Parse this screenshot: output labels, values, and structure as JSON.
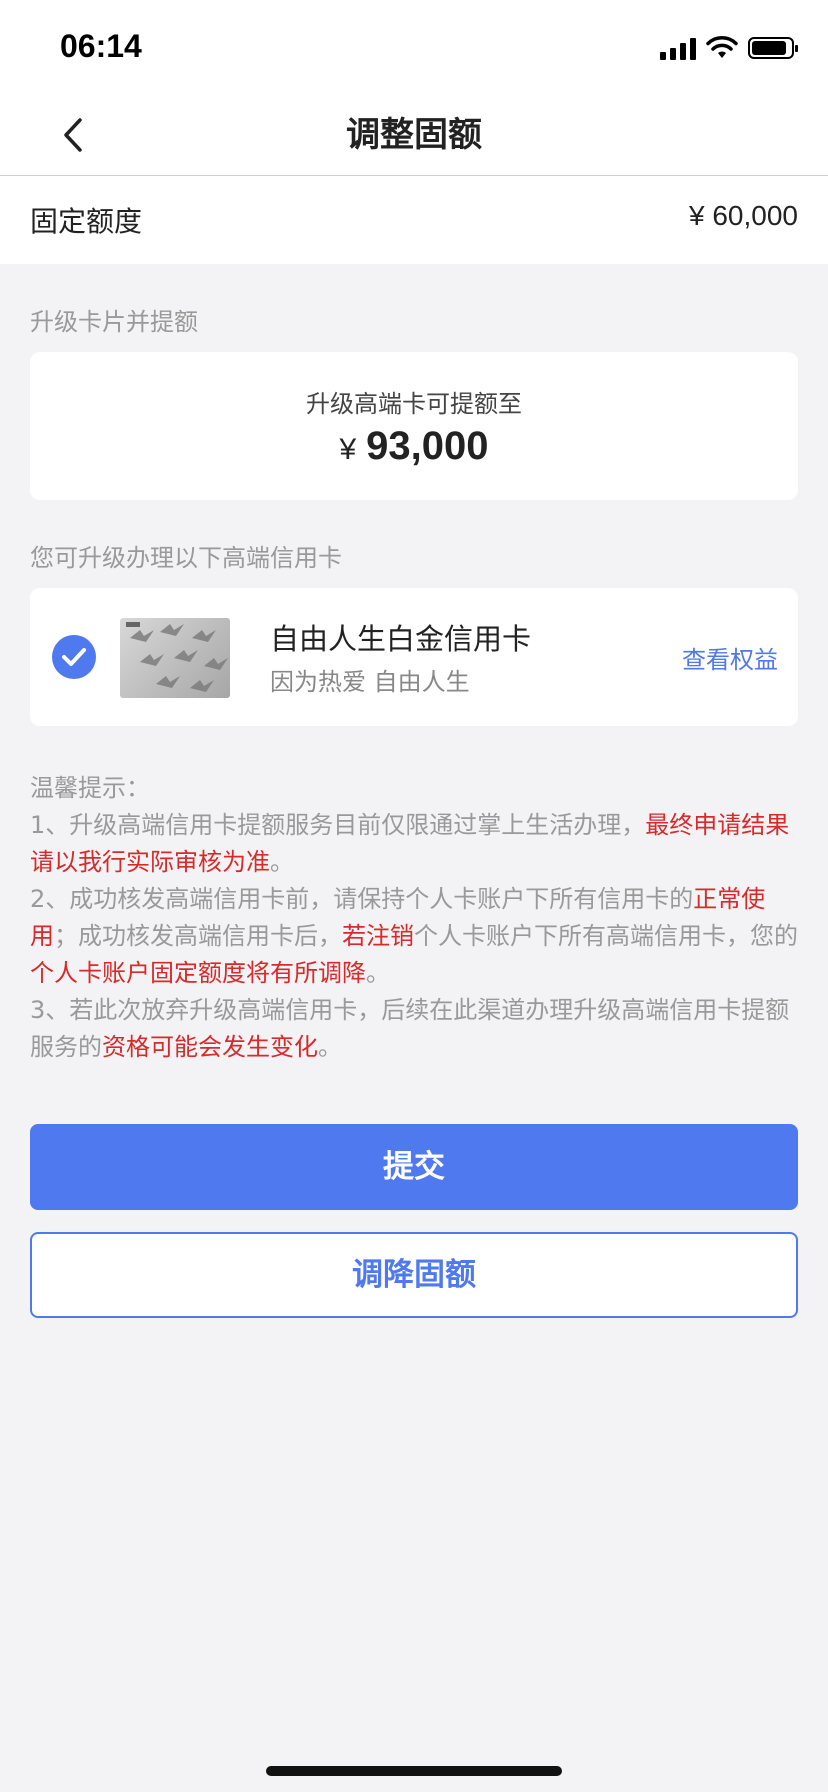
{
  "status_bar": {
    "time": "06:14"
  },
  "nav": {
    "title": "调整固额"
  },
  "fixed_limit": {
    "label": "固定额度",
    "value": "¥ 60,000"
  },
  "upgrade_section": {
    "title": "升级卡片并提额",
    "caption": "升级高端卡可提额至",
    "currency": "¥",
    "amount": "93,000"
  },
  "card_section": {
    "title": "您可升级办理以下高端信用卡",
    "card": {
      "name": "自由人生白金信用卡",
      "slogan": "因为热爱 自由人生",
      "action": "查看权益",
      "selected": true
    }
  },
  "tips": {
    "heading": "温馨提示：",
    "tip1": {
      "a": "1、升级高端信用卡提额服务目前仅限通过掌上生活办理，",
      "red1": "最终申请结果请以我行实际审核为准",
      "b": "。"
    },
    "tip2": {
      "a": "2、成功核发高端信用卡前，请保持个人卡账户下所有信用卡的",
      "red1": "正常使用",
      "b": "；成功核发高端信用卡后，",
      "red2": "若注销",
      "c": "个人卡账户下所有高端信用卡，您的",
      "red3": "个人卡账户固定额度将有所调降",
      "d": "。"
    },
    "tip3": {
      "a": "3、若此次放弃升级高端信用卡，后续在此渠道办理升级高端信用卡提额服务的",
      "red1": "资格可能会发生变化",
      "b": "。"
    }
  },
  "buttons": {
    "submit": "提交",
    "reduce": "调降固额"
  },
  "colors": {
    "primary": "#4f79ee",
    "warning": "#d72a2a",
    "background": "#f3f3f5"
  }
}
